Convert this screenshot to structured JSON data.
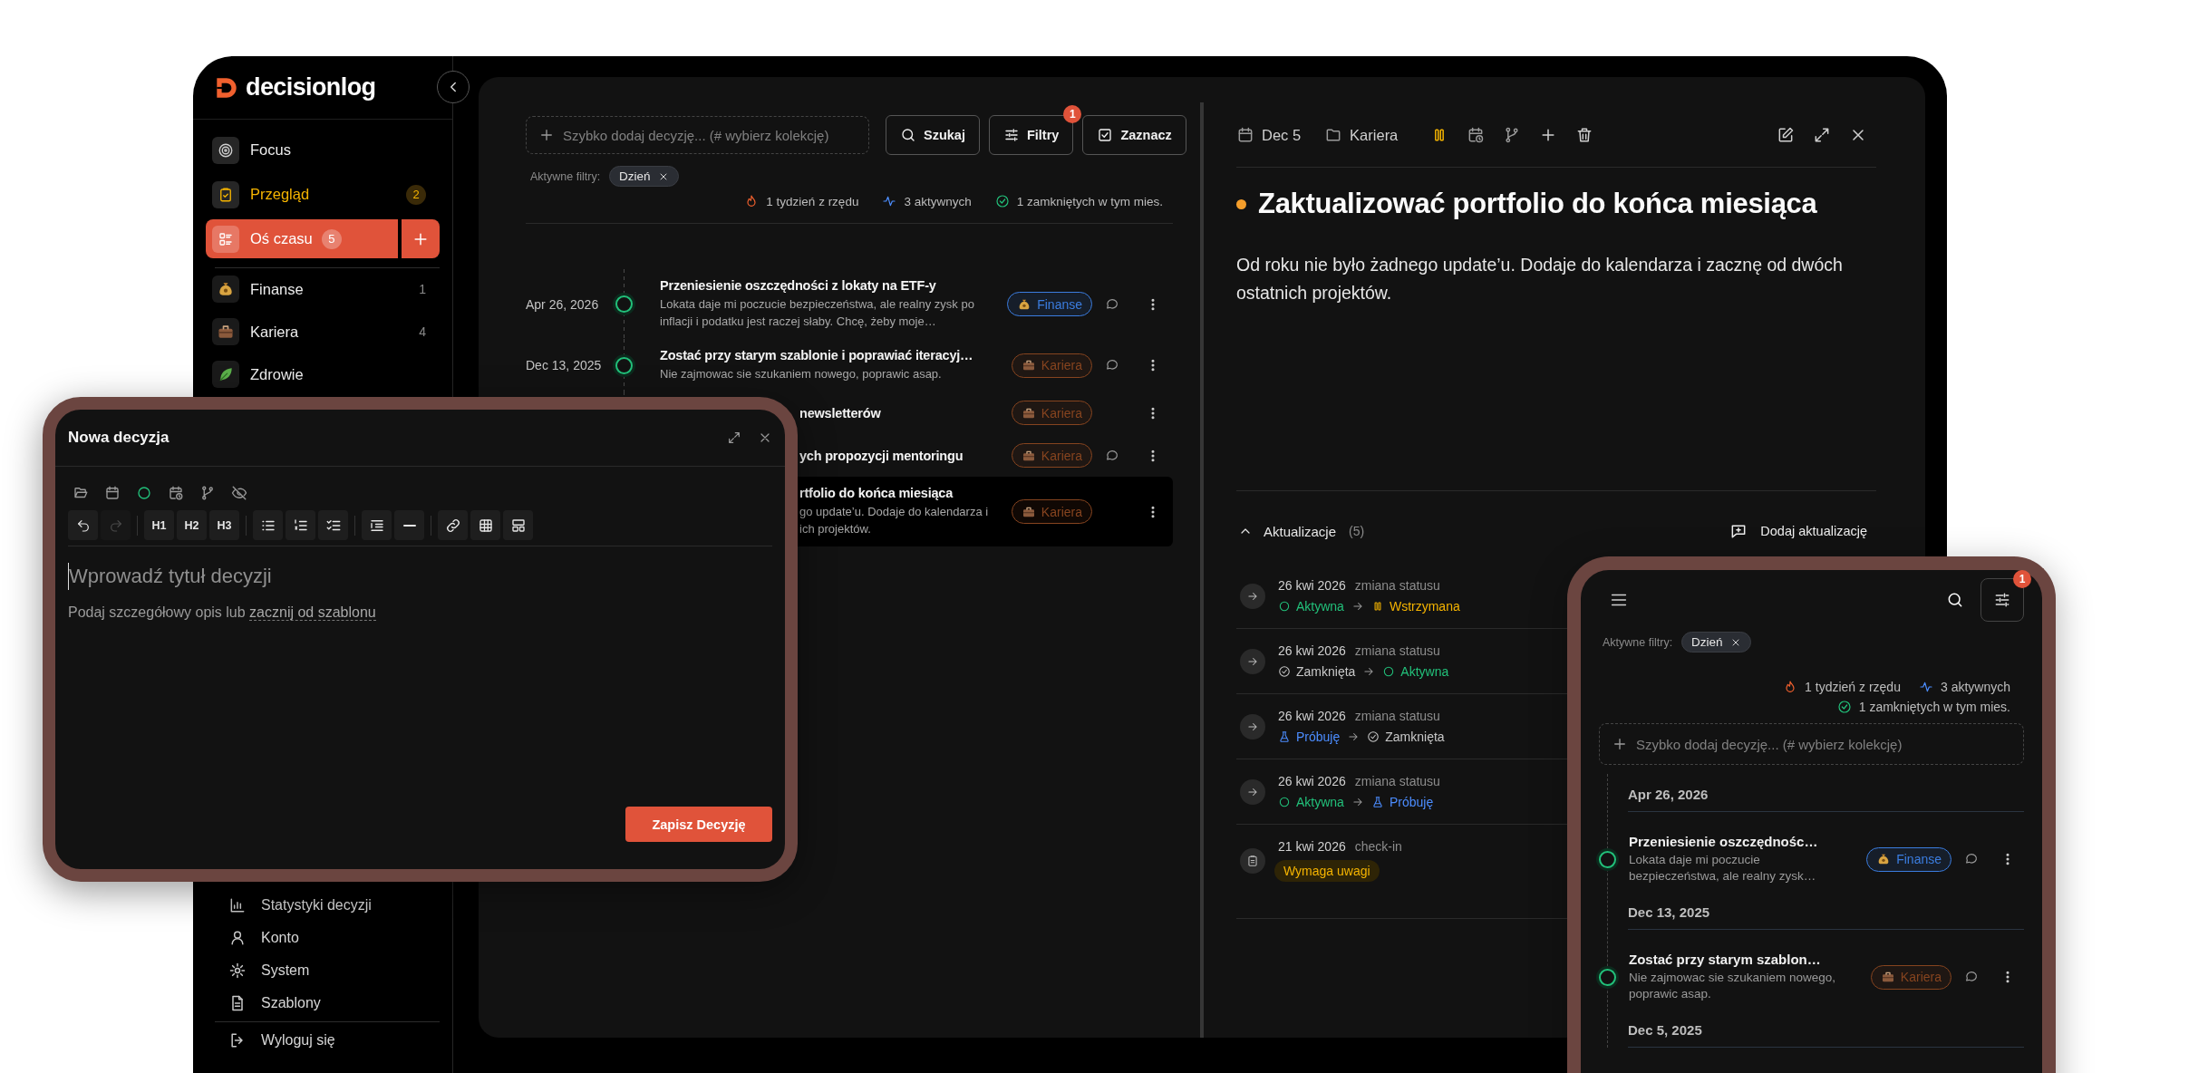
{
  "sidebar": {
    "logo": "decisionlog",
    "nav": [
      {
        "label": "Focus",
        "selected": false,
        "highlighted": false
      },
      {
        "label": "Przegląd",
        "count": "2",
        "selected": false,
        "highlighted": true
      },
      {
        "label": "Oś czasu",
        "count": "5",
        "selected": true,
        "highlighted": false
      }
    ],
    "collections": [
      {
        "label": "Finanse",
        "count": "1",
        "kind": "money"
      },
      {
        "label": "Kariera",
        "count": "4",
        "kind": "work"
      },
      {
        "label": "Zdrowie",
        "kind": "plant"
      }
    ],
    "bottom": [
      {
        "label": "Statystyki decyzji"
      },
      {
        "label": "Konto"
      },
      {
        "label": "System"
      },
      {
        "label": "Szablony"
      }
    ],
    "logout": "Wyloguj się"
  },
  "timeline": {
    "quick_add": {
      "placeholder": "Szybko dodaj decyzję... (# wybierz kolekcję)"
    },
    "buttons": [
      {
        "label": "Szukaj"
      },
      {
        "label": "Filtry",
        "badge": "1"
      },
      {
        "label": "Zaznacz"
      }
    ],
    "filters_label": "Aktywne filtry:",
    "filters": [
      "Dzień"
    ],
    "stats": [
      "1 tydzień z rzędu",
      "3 aktywnych",
      "1 zamkniętych w tym mies."
    ],
    "rows": [
      {
        "date": "Apr 26, 2026",
        "title": "Przeniesienie oszczędności z lokaty na ETF-y",
        "description": [
          "Lokata daje mi poczucie bezpieczeństwa, ale realny zysk po inflacji i podatku jest raczej słaby. Chcę, żeby moje…"
        ],
        "tag": {
          "label": "Finanse",
          "kind": "money",
          "color": "#3b7de0"
        },
        "comments": true,
        "selected": false
      },
      {
        "date": "Dec 13, 2025",
        "title": "Zostać przy starym szablonie i poprawiać iteracyj…",
        "description": [
          "Nie zajmowac sie szukaniem nowego, poprawic asap."
        ],
        "tag": {
          "label": "Kariera",
          "kind": "work",
          "color": "#86441f"
        },
        "comments": true,
        "selected": false
      },
      {
        "title": "newsletterów",
        "tag": {
          "label": "Kariera",
          "kind": "work",
          "color": "#86441f"
        },
        "comments": false,
        "selected": false
      },
      {
        "title": "ych propozycji mentoringu",
        "tag": {
          "label": "Kariera",
          "kind": "work",
          "color": "#86441f"
        },
        "comments": true,
        "selected": false
      },
      {
        "title": "rtfolio do końca miesiąca",
        "description": [
          "go update’u. Dodaje do kalendarza i",
          "ich projektów."
        ],
        "tag": {
          "label": "Kariera",
          "kind": "work",
          "color": "#86441f"
        },
        "comments": false,
        "selected": true
      }
    ]
  },
  "detail": {
    "date": "Dec 5",
    "collection": "Kariera",
    "kind": "paused",
    "title": "Zaktualizować portfolio do końca miesiąca",
    "body": "Od roku nie było żadnego update’u. Dodaje do kalendarza i zacznę od dwóch ostatnich projektów.",
    "updates": {
      "label": "Aktualizacje",
      "count": "(5)",
      "expanded": true,
      "add_label": "Dodaj aktualizację",
      "items": [
        {
          "kind": "status_change",
          "date": "26 kwi 2026",
          "type": "zmiana statusu",
          "from": {
            "kind": "active",
            "label": "Aktywna"
          },
          "to": {
            "kind": "paused",
            "label": "Wstrzymana"
          }
        },
        {
          "kind": "status_change",
          "date": "26 kwi 2026",
          "type": "zmiana statusu",
          "from": {
            "kind": "closed",
            "label": "Zamknięta"
          },
          "to": {
            "kind": "active",
            "label": "Aktywna"
          }
        },
        {
          "kind": "status_change",
          "date": "26 kwi 2026",
          "type": "zmiana statusu",
          "from": {
            "kind": "trying",
            "label": "Próbuję"
          },
          "to": {
            "kind": "closed",
            "label": "Zamknięta"
          }
        },
        {
          "kind": "status_change",
          "date": "26 kwi 2026",
          "type": "zmiana statusu",
          "from": {
            "kind": "active",
            "label": "Aktywna"
          },
          "to": {
            "kind": "trying",
            "label": "Próbuję"
          }
        },
        {
          "kind": "check_in",
          "date": "21 kwi 2026",
          "type": "check-in",
          "tag": "Wymaga uwagi"
        }
      ]
    }
  },
  "modal": {
    "title": "Nowa decyzja",
    "history": [
      {
        "kind": "undo",
        "disabled": false
      },
      {
        "kind": "redo",
        "disabled": true
      }
    ],
    "headings": [
      "H1",
      "H2",
      "H3"
    ],
    "title_placeholder": "Wprowadź tytuł decyzji",
    "description_placeholder": "Podaj szczegółowy opis lub",
    "template_link": "zacznij od szablonu",
    "save": "Zapisz Decyzję"
  },
  "phone": {
    "filter_badge": "1",
    "filters_label": "Aktywne filtry:",
    "filters": [
      "Dzień"
    ],
    "stats": [
      "1 tydzień z rzędu",
      "3 aktywnych",
      "1 zamkniętych w tym mies."
    ],
    "quick_add": {
      "placeholder": "Szybko dodaj decyzję... (# wybierz kolekcję)"
    },
    "groups": [
      {
        "date": "Apr 26, 2026",
        "rows": [
          {
            "title": "Przeniesienie oszczędnośc…",
            "description": "Lokata daje mi poczucie bezpieczeństwa, ale realny zysk…",
            "tag": {
              "label": "Finanse",
              "kind": "money",
              "color": "#3b7de0"
            }
          }
        ]
      },
      {
        "date": "Dec 13, 2025",
        "rows": [
          {
            "title": "Zostać przy starym szablon…",
            "description": "Nie zajmowac sie szukaniem nowego, poprawic asap.",
            "tag": {
              "label": "Kariera",
              "kind": "work",
              "color": "#86441f"
            }
          }
        ]
      },
      {
        "date": "Dec 5, 2025"
      }
    ]
  }
}
